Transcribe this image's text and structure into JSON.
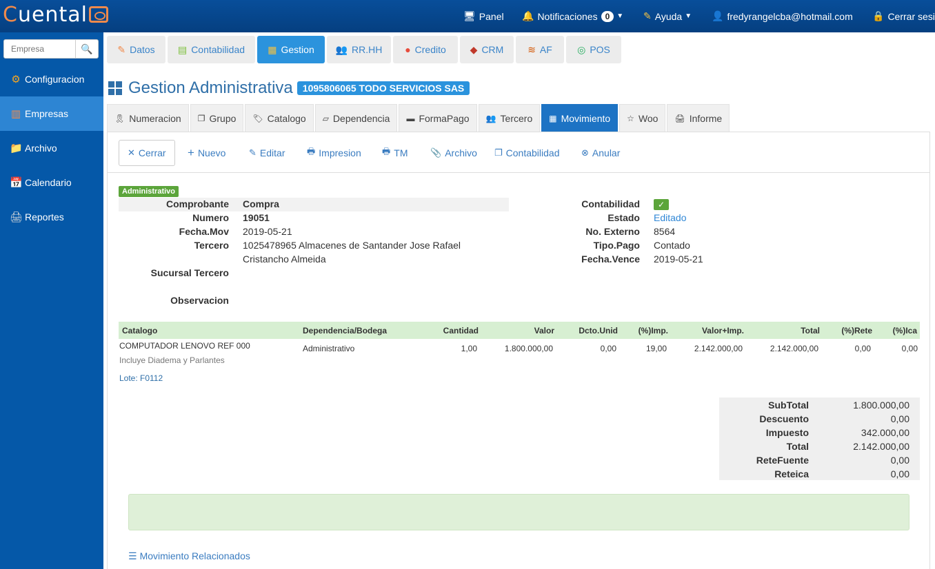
{
  "app": {
    "logo_prefix": "Cuenta",
    "logo_suffix": "l"
  },
  "topbar": {
    "panel": "Panel",
    "notifications": "Notificaciones",
    "notifications_count": "0",
    "help": "Ayuda",
    "user": "fredyrangelcba@hotmail.com",
    "logout": "Cerrar sesi"
  },
  "sidebar": {
    "search_placeholder": "Empresa",
    "items": [
      {
        "label": "Configuracion",
        "icon": "gear-icon"
      },
      {
        "label": "Empresas",
        "icon": "books-icon"
      },
      {
        "label": "Archivo",
        "icon": "folder-icon"
      },
      {
        "label": "Calendario",
        "icon": "calendar-icon"
      },
      {
        "label": "Reportes",
        "icon": "printer-icon"
      }
    ]
  },
  "modules": [
    {
      "label": "Datos"
    },
    {
      "label": "Contabilidad"
    },
    {
      "label": "Gestion"
    },
    {
      "label": "RR.HH"
    },
    {
      "label": "Credito"
    },
    {
      "label": "CRM"
    },
    {
      "label": "AF"
    },
    {
      "label": "POS"
    }
  ],
  "page": {
    "title": "Gestion Administrativa",
    "company": "1095806065 TODO SERVICIOS SAS"
  },
  "subtabs": [
    {
      "label": "Numeracion"
    },
    {
      "label": "Grupo"
    },
    {
      "label": "Catalogo"
    },
    {
      "label": "Dependencia"
    },
    {
      "label": "FormaPago"
    },
    {
      "label": "Tercero"
    },
    {
      "label": "Movimiento"
    },
    {
      "label": "Woo"
    },
    {
      "label": "Informe"
    }
  ],
  "toolbar": {
    "close": "Cerrar",
    "new": "Nuevo",
    "edit": "Editar",
    "print": "Impresion",
    "tm": "TM",
    "file": "Archivo",
    "accounting": "Contabilidad",
    "cancel": "Anular"
  },
  "record": {
    "tag": "Administrativo",
    "labels": {
      "comprobante": "Comprobante",
      "numero": "Numero",
      "fecha_mov": "Fecha.Mov",
      "tercero": "Tercero",
      "sucursal": "Sucursal Tercero",
      "observacion": "Observacion",
      "contabilidad": "Contabilidad",
      "estado": "Estado",
      "no_externo": "No. Externo",
      "tipo_pago": "Tipo.Pago",
      "fecha_vence": "Fecha.Vence"
    },
    "values": {
      "comprobante": "Compra",
      "numero": "19051",
      "fecha_mov": "2019-05-21",
      "tercero_line1": "1025478965 Almacenes de Santander Jose Rafael",
      "tercero_line2": "Cristancho Almeida",
      "estado": "Editado",
      "no_externo": "8564",
      "tipo_pago": "Contado",
      "fecha_vence": "2019-05-21"
    }
  },
  "items_table": {
    "headers": {
      "catalogo": "Catalogo",
      "dependencia": "Dependencia/Bodega",
      "cantidad": "Cantidad",
      "valor": "Valor",
      "dcto": "Dcto.Unid",
      "imp": "(%)Imp.",
      "valor_imp": "Valor+Imp.",
      "total": "Total",
      "rete": "(%)Rete",
      "ica": "(%)Ica"
    },
    "row": {
      "catalogo": "COMPUTADOR LENOVO REF 000",
      "catalogo_note": "Incluye Diadema y Parlantes",
      "lote": "Lote: F0112",
      "dependencia": "Administrativo",
      "cantidad": "1,00",
      "valor": "1.800.000,00",
      "dcto": "0,00",
      "imp": "19,00",
      "valor_imp": "2.142.000,00",
      "total": "2.142.000,00",
      "rete": "0,00",
      "ica": "0,00"
    }
  },
  "totals": {
    "subtotal_label": "SubTotal",
    "subtotal": "1.800.000,00",
    "descuento_label": "Descuento",
    "descuento": "0,00",
    "impuesto_label": "Impuesto",
    "impuesto": "342.000,00",
    "total_label": "Total",
    "total": "2.142.000,00",
    "retefuente_label": "ReteFuente",
    "retefuente": "0,00",
    "reteica_label": "Reteica",
    "reteica": "0,00"
  },
  "related": {
    "label": "Movimiento Relacionados"
  },
  "colors": {
    "topbar": "#084e9a",
    "sidebar": "#0558a8",
    "accent": "#2b93dd",
    "active_subtab": "#1d73c4",
    "success": "#5ca53b",
    "logo_accent": "#f08a4b"
  }
}
